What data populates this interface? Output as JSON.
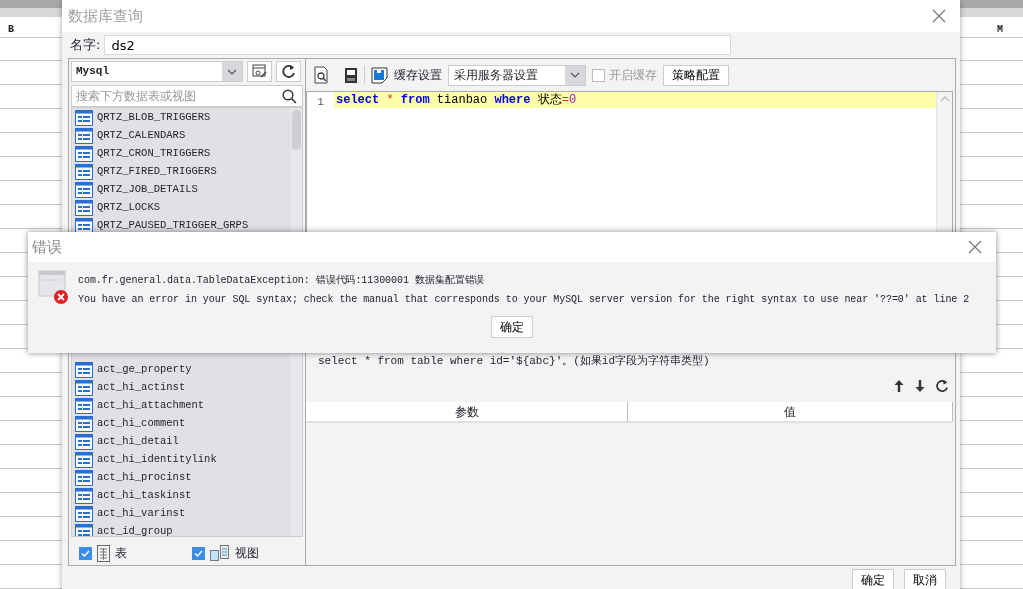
{
  "sheet": {
    "columns": [
      "B",
      "M"
    ]
  },
  "window": {
    "title": "数据库查询",
    "name_label": "名字:",
    "name_value": "ds2"
  },
  "datasource": {
    "connection": "Mysql",
    "search_placeholder": "搜索下方数据表或视图",
    "tables": [
      "QRTZ_BLOB_TRIGGERS",
      "QRTZ_CALENDARS",
      "QRTZ_CRON_TRIGGERS",
      "QRTZ_FIRED_TRIGGERS",
      "QRTZ_JOB_DETAILS",
      "QRTZ_LOCKS",
      "QRTZ_PAUSED_TRIGGER_GRPS",
      "act_ge_property",
      "act_hi_actinst",
      "act_hi_attachment",
      "act_hi_comment",
      "act_hi_detail",
      "act_hi_identitylink",
      "act_hi_procinst",
      "act_hi_taskinst",
      "act_hi_varinst",
      "act_id_group"
    ],
    "filters": [
      {
        "label": "表",
        "checked": true,
        "kind": "table"
      },
      {
        "label": "视图",
        "checked": true,
        "kind": "view"
      }
    ]
  },
  "toolbar": {
    "cache_label": "缓存设置",
    "cache_mode": "采用服务器设置",
    "enable_cache": {
      "label": "开启缓存",
      "checked": false,
      "disabled": true
    },
    "strategy_button": "策略配置"
  },
  "editor": {
    "lines": [
      {
        "number": "1",
        "tokens": [
          {
            "text": "select",
            "kind": "keyword"
          },
          {
            "text": " * ",
            "kind": "operator"
          },
          {
            "text": "from",
            "kind": "keyword"
          },
          {
            "text": " tianbao ",
            "kind": "plain"
          },
          {
            "text": "where",
            "kind": "keyword"
          },
          {
            "text": " 状态",
            "kind": "plain"
          },
          {
            "text": "=",
            "kind": "operator"
          },
          {
            "text": "0",
            "kind": "number"
          }
        ]
      }
    ]
  },
  "hints": [
    "select * from table where id='${abc}'。(如果id字段为字符串类型)"
  ],
  "params_table": {
    "columns": [
      "参数",
      "值"
    ]
  },
  "buttons": [
    "确定",
    "取消"
  ],
  "error_dialog": {
    "title": "错误",
    "message": "com.fr.general.data.TableDataException: 错误代码:11300001 数据集配置错误",
    "detail": "You have an error in your SQL syntax; check the manual that corresponds to your MySQL server version for the right syntax to use near '??=0' at line 2",
    "button": "确定"
  }
}
